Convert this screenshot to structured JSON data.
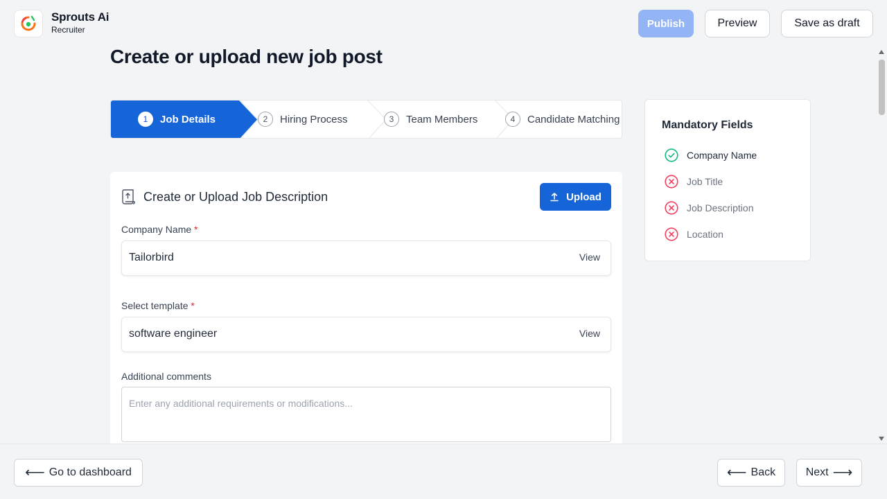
{
  "brand": {
    "name": "Sprouts Ai",
    "sub": "Recruiter",
    "colors": {
      "green": "#22c55e",
      "orange": "#f97316",
      "red": "#ef4444"
    }
  },
  "header": {
    "publish_label": "Publish",
    "preview_label": "Preview",
    "draft_label": "Save as draft"
  },
  "page": {
    "title": "Create or upload new job post"
  },
  "stepper": {
    "active_color": "#1665d8",
    "steps": [
      {
        "num": "1",
        "label": "Job Details",
        "active": true
      },
      {
        "num": "2",
        "label": "Hiring Process",
        "active": false
      },
      {
        "num": "3",
        "label": "Team Members",
        "active": false
      },
      {
        "num": "4",
        "label": "Candidate Matching",
        "active": false
      }
    ]
  },
  "mandatory": {
    "title": "Mandatory Fields",
    "items": [
      {
        "label": "Company Name",
        "status": "complete",
        "icon": "check-circle-icon",
        "color": "#10b981"
      },
      {
        "label": "Job Title",
        "status": "missing",
        "icon": "x-circle-icon",
        "color": "#f43f5e"
      },
      {
        "label": "Job Description",
        "status": "missing",
        "icon": "x-circle-icon",
        "color": "#f43f5e"
      },
      {
        "label": "Location",
        "status": "missing",
        "icon": "x-circle-icon",
        "color": "#f43f5e"
      }
    ]
  },
  "form": {
    "title": "Create or Upload Job Description",
    "upload_label": "Upload",
    "company": {
      "label": "Company Name",
      "required": "*",
      "value": "Tailorbird",
      "view_label": "View"
    },
    "template": {
      "label": "Select template",
      "required": "*",
      "value": "software engineer",
      "view_label": "View"
    },
    "comments": {
      "label": "Additional comments",
      "placeholder": "Enter any additional requirements or modifications..."
    }
  },
  "footer": {
    "dashboard_label": "Go to dashboard",
    "back_label": "Back",
    "next_label": "Next",
    "arrow_left": "⟵",
    "arrow_right": "⟶"
  }
}
